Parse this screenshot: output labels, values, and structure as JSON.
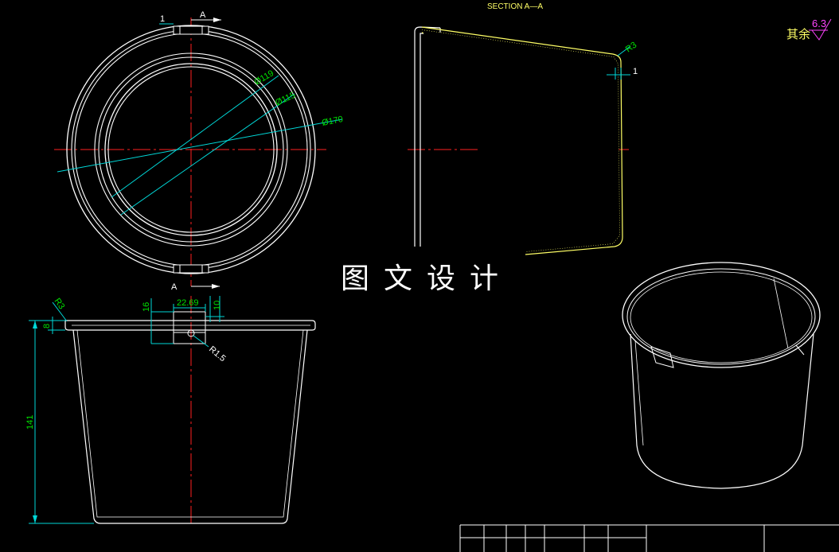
{
  "colors": {
    "background": "#000000",
    "outline": "#ffffff",
    "centerline": "#ff2020",
    "dimension": "#00e000",
    "leader": "#00d8d8",
    "section_outline": "#ffff66",
    "surface_symbol": "#ff44ff"
  },
  "top_view": {
    "section_marker_top": "A",
    "section_marker_bottom": "A",
    "gap_label": "1",
    "diameters": [
      "Ø119",
      "Ø115",
      "Ø170"
    ]
  },
  "section_view": {
    "title": "SECTION A—A",
    "radius_label": "R3",
    "thickness_label": "1"
  },
  "front_view": {
    "rim_radius": "R3",
    "rim_height": "8",
    "height": "141",
    "slot_height": "16",
    "slot_width": "22.69",
    "tab_width": "10",
    "hole_radius": "R1.5"
  },
  "watermark": "图文设计",
  "roughness": {
    "note": "其余",
    "value": "6.3"
  },
  "title_block": {
    "columns": 8
  }
}
